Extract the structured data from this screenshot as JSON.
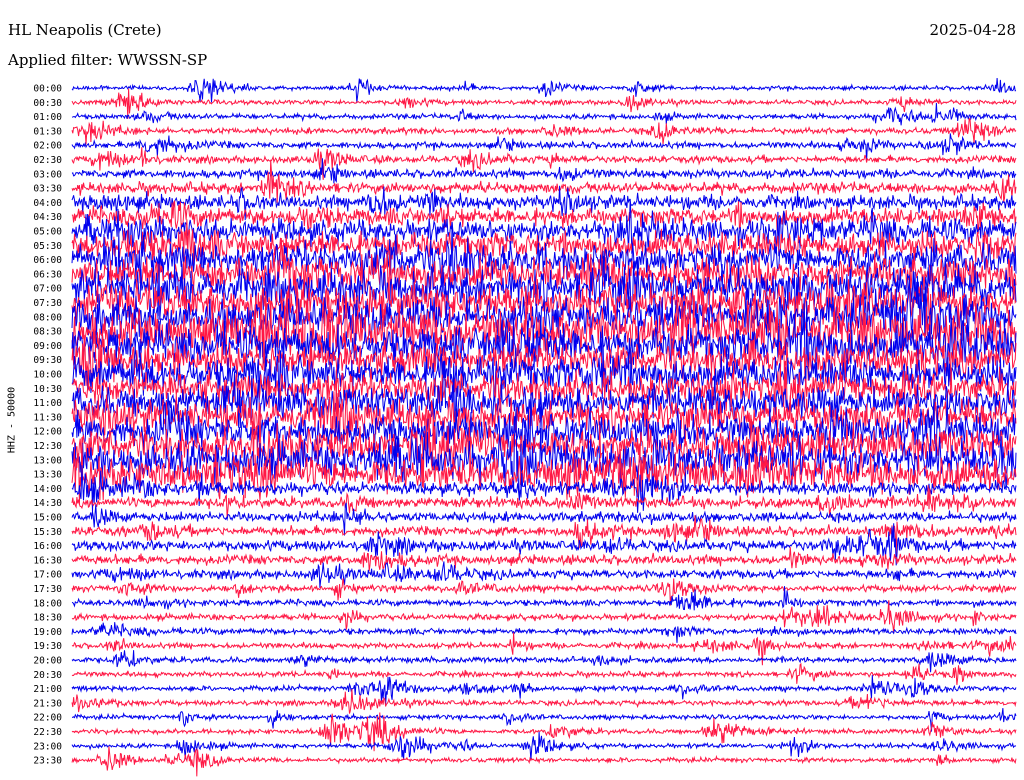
{
  "header": {
    "station": "HL Neapolis (Crete)",
    "date": "2025-04-28",
    "filter": "Applied filter: WWSSN-SP"
  },
  "chart_data": {
    "type": "line",
    "title": "HL Neapolis (Crete)",
    "ylabel": "HHZ - 50000",
    "colors": {
      "even_rows": "#0000ee",
      "odd_rows": "#ff1744"
    },
    "row_labels": [
      "00:00",
      "00:30",
      "01:00",
      "01:30",
      "02:00",
      "02:30",
      "03:00",
      "03:30",
      "04:00",
      "04:30",
      "05:00",
      "05:30",
      "06:00",
      "06:30",
      "07:00",
      "07:30",
      "08:00",
      "08:30",
      "09:00",
      "09:30",
      "10:00",
      "10:30",
      "11:00",
      "11:30",
      "12:00",
      "12:30",
      "13:00",
      "13:30",
      "14:00",
      "14:30",
      "15:00",
      "15:30",
      "16:00",
      "16:30",
      "17:00",
      "17:30",
      "18:00",
      "18:30",
      "19:00",
      "19:30",
      "20:00",
      "20:30",
      "21:00",
      "21:30",
      "22:00",
      "22:30",
      "23:00",
      "23:30"
    ],
    "activity_level": [
      0.25,
      0.3,
      0.35,
      0.45,
      0.5,
      0.55,
      0.7,
      0.9,
      1.2,
      1.6,
      2.2,
      2.6,
      3.0,
      3.2,
      3.4,
      3.5,
      3.6,
      4.2,
      3.6,
      3.2,
      3.2,
      3.0,
      3.0,
      3.0,
      3.1,
      3.2,
      3.6,
      3.2,
      1.1,
      0.9,
      0.8,
      0.8,
      0.9,
      0.8,
      0.7,
      0.5,
      0.45,
      0.45,
      0.45,
      0.4,
      0.4,
      0.35,
      0.35,
      0.35,
      0.3,
      0.3,
      0.3,
      0.3
    ]
  }
}
